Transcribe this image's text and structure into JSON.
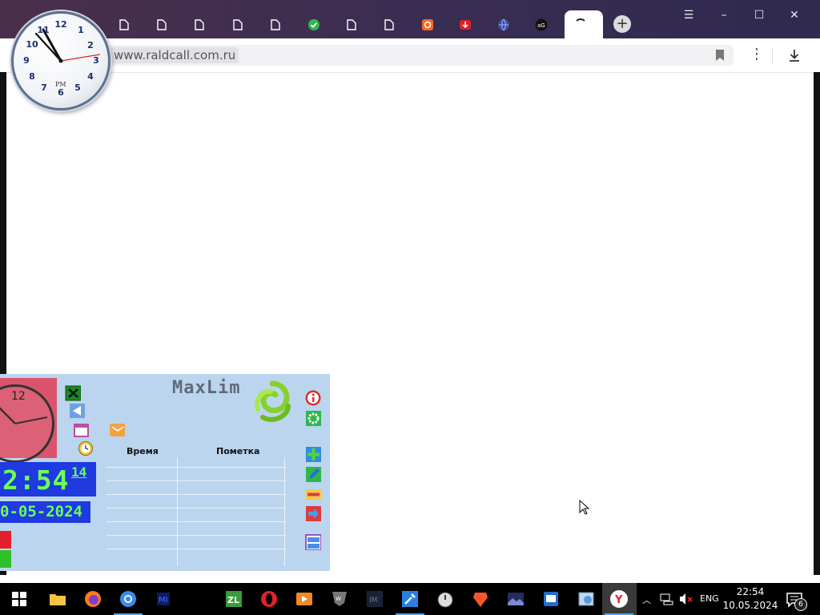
{
  "browser": {
    "url": "www.raldcall.com.ru",
    "tabs_count": 14,
    "new_tab_label": "+",
    "menu_icon": "hamburger-icon",
    "window_controls": [
      "minimize-icon",
      "maximize-icon",
      "close-icon"
    ]
  },
  "desktop_clock": {
    "numbers": [
      "12",
      "1",
      "2",
      "3",
      "4",
      "5",
      "6",
      "7",
      "8",
      "9",
      "10",
      "11"
    ],
    "period": "PM"
  },
  "maxlim": {
    "title": "MaxLim",
    "time": "2:54",
    "seconds": "14",
    "date": "0-05-2024",
    "clock_label": "12",
    "columns": [
      "Время",
      "Пометка"
    ],
    "colors": {
      "panel": "#bcd5ee",
      "digits": "#6bff57",
      "digit_bg": "#1f3adf",
      "clock_bg": "#d9546c"
    }
  },
  "taskbar": {
    "tray": {
      "language": "ENG",
      "notifications": "6"
    },
    "clock": {
      "time": "22:54",
      "date": "10.05.2024"
    }
  }
}
